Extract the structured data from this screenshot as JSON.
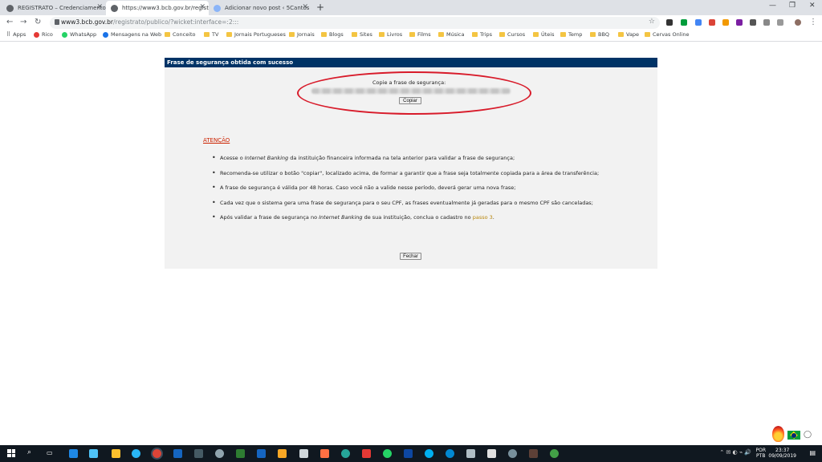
{
  "browser": {
    "tabs": [
      {
        "title": "REGISTRATO – Credenciamento",
        "favicon_color": "#5f6368",
        "active": false
      },
      {
        "title": "https://www3.bcb.gov.br/registr",
        "favicon_color": "#5f6368",
        "active": true
      },
      {
        "title": "Adicionar novo post ‹ 5Cantos —",
        "favicon_color": "#8ab4f8",
        "active": false
      }
    ],
    "url_domain": "www3.bcb.gov.br",
    "url_path": "/registrato/publico/?wicket:interface=:2:::",
    "bookmarks": [
      {
        "label": "Apps",
        "kind": "apps"
      },
      {
        "label": "Rico",
        "kind": "site",
        "color": "#e53935"
      },
      {
        "label": "WhatsApp",
        "kind": "site",
        "color": "#25d366"
      },
      {
        "label": "Mensagens na Web",
        "kind": "site",
        "color": "#1a73e8"
      },
      {
        "label": "Conceito",
        "kind": "folder"
      },
      {
        "label": "TV",
        "kind": "folder"
      },
      {
        "label": "Jornais Portugueses",
        "kind": "folder"
      },
      {
        "label": "Jornais",
        "kind": "folder"
      },
      {
        "label": "Blogs",
        "kind": "folder"
      },
      {
        "label": "Sites",
        "kind": "folder"
      },
      {
        "label": "Livros",
        "kind": "folder"
      },
      {
        "label": "Films",
        "kind": "folder"
      },
      {
        "label": "Música",
        "kind": "folder"
      },
      {
        "label": "Trips",
        "kind": "folder"
      },
      {
        "label": "Cursos",
        "kind": "folder"
      },
      {
        "label": "Úteis",
        "kind": "folder"
      },
      {
        "label": "Temp",
        "kind": "folder"
      },
      {
        "label": "BBQ",
        "kind": "folder"
      },
      {
        "label": "Vape",
        "kind": "folder"
      },
      {
        "label": "Cervas Online",
        "kind": "folder"
      }
    ]
  },
  "panel": {
    "header_title": "Frase de segurança obtida com sucesso",
    "copy_label": "Copie a frase de segurança:",
    "copy_button": "Copiar",
    "atencao": "ATENÇÃO",
    "bullets": [
      {
        "pre": "Acesse o ",
        "em": "Internet Banking",
        "post": " da instituição financeira informada na tela anterior para validar a frase de segurança;"
      },
      {
        "pre": "Recomenda-se utilizar o botão \"copiar\", localizado acima, de formar a garantir que a frase seja totalmente copiada para a área de transferência;",
        "em": "",
        "post": ""
      },
      {
        "pre": "A frase de segurança é válida por 48 horas. Caso você não a valide nesse período, deverá gerar uma nova frase;",
        "em": "",
        "post": ""
      },
      {
        "pre": "Cada vez que o sistema gera uma frase de segurança para o seu CPF, as frases eventualmente já geradas para o mesmo CPF são canceladas;",
        "em": "",
        "post": ""
      },
      {
        "pre": "Após validar a frase de segurança no ",
        "em": "Internet Banking",
        "post": " de sua instituição, conclua o cadastro no ",
        "link": "passo 3",
        "end": "."
      }
    ],
    "close_button": "Fechar"
  },
  "taskbar": {
    "lang_top": "POR",
    "lang_bottom": "PTB",
    "time": "23:37",
    "date": "09/09/2019"
  },
  "colors": {
    "header_bg": "#003366",
    "atencao": "#cc2200",
    "highlight_ellipse": "#d81b2a",
    "link": "#b8860b"
  }
}
